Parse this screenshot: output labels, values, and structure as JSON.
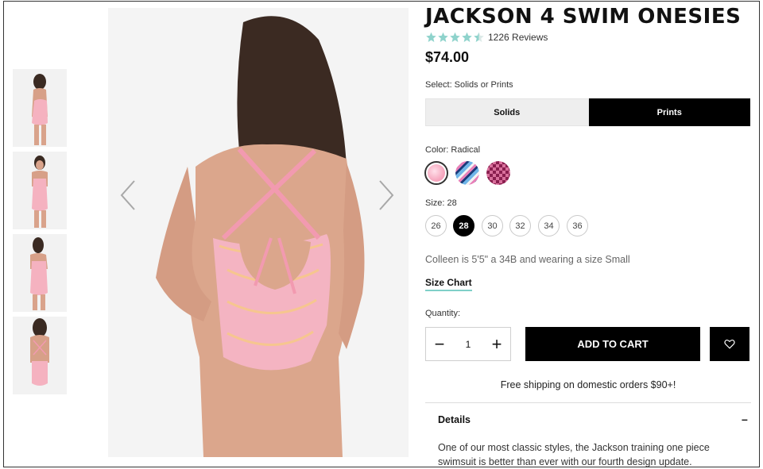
{
  "product": {
    "title": "JACKSON 4 SWIM ONESIES",
    "rating_value": 4.5,
    "reviews": "1226 Reviews",
    "price": "$74.00"
  },
  "select": {
    "label": "Select: Solids or Prints",
    "options": [
      "Solids",
      "Prints"
    ],
    "selected": "Prints"
  },
  "color": {
    "label": "Color: Radical",
    "swatches": [
      {
        "name": "radical",
        "color": "#f6b8c8"
      },
      {
        "name": "stripe",
        "color": "#6fb5e8"
      },
      {
        "name": "check",
        "color": "#8a1f4f"
      }
    ]
  },
  "size": {
    "label": "Size: 28",
    "options": [
      "26",
      "28",
      "30",
      "32",
      "34",
      "36"
    ],
    "selected": "28"
  },
  "model_note": "Colleen is 5'5\" a 34B and wearing a size Small",
  "size_chart_label": "Size Chart",
  "quantity": {
    "label": "Quantity:",
    "minus": "−",
    "value": "1",
    "plus": "+"
  },
  "add_to_cart_label": "ADD TO CART",
  "shipping_note": "Free shipping on domestic orders $90+!",
  "details": {
    "title": "Details",
    "toggle": "–",
    "text": "One of our most classic styles, the Jackson training one piece swimsuit is better than ever with our fourth design update."
  },
  "colors": {
    "star": "#8fd3cc",
    "accent_underline": "#7fd0c8",
    "primary_button": "#000000"
  },
  "icons": {
    "prev": "chevron-left-icon",
    "next": "chevron-right-icon",
    "wishlist": "heart-icon"
  }
}
